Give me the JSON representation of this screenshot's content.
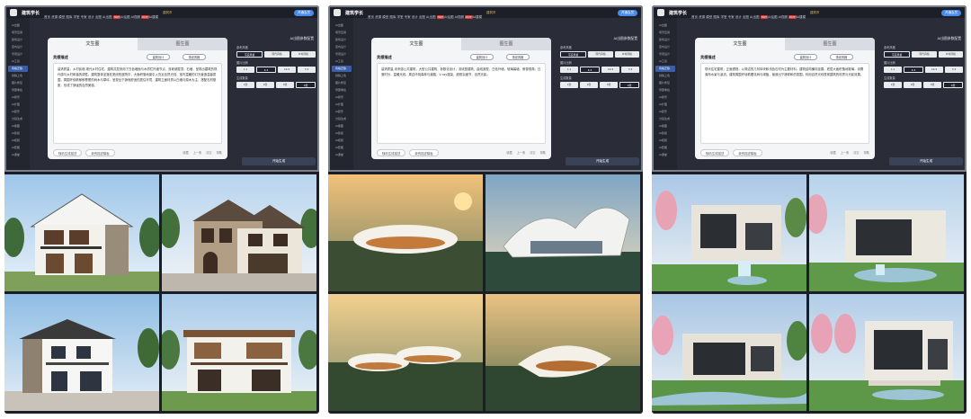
{
  "panels": [
    {
      "app": {
        "brand": "建筑学长",
        "nav": [
          "首页",
          "资源",
          "模型",
          "图库",
          "学堂",
          "专家",
          "设计",
          "出图",
          "AI出图",
          "AI绘图",
          "AI视频",
          "AI建模",
          "AI导入",
          "AI换景",
          "AI插件",
          "AI编辑",
          "AI套图",
          "AI课堂",
          "AI招聘",
          "AI工具",
          "AI渲染"
        ],
        "hot_label": "HOT",
        "coin": "建筑币",
        "vip_button": "开通会员",
        "sidebar": [
          "AI出图",
          "场景应用",
          "建筑设计",
          "室内设计",
          "景观设计",
          "AI工具",
          "风格迁移",
          "线稿上色",
          "图片修复",
          "局部重绘",
          "AI换景",
          "AI扩图",
          "AI配景",
          "分镜生成",
          "AI抠图",
          "AI建模",
          "AI视频",
          "AI套图",
          "AI课堂"
        ],
        "sidebar_active": 6,
        "tabs": [
          "文生图",
          "图生图"
        ],
        "desc_label": "灵感描述",
        "chips": [
          "建筑设计",
          "场景风格"
        ],
        "prompt": "高清质量，乡村民宿,现代乡村住宅，建筑共层采用了白色墙面与木质栏杆细节点，双坡坡屋顶，石墙，呈现出建筑的现代感与乡村和谐的调性，建筑整体坐落在宽阔的庭院中，大面积落地窗引入充足自然光线，室内温暖的灯光营造温馨氛围，周围环绕着郁郁葱葱的树木与草坪，呈现出宁静而舒适的居住环境，建筑立面材质以白墙与原木为主，搭配石材基座，形成了静谧的自然美感。",
        "bottom_buttons": [
          "随机生成描述",
          "我的描述模板"
        ],
        "controls": [
          "收藏",
          "上一条",
          "清空",
          "帮助"
        ],
        "right_title": "AI出图参数配置",
        "right_labels": [
          "参考风格",
          "图片比例",
          "生成数量"
        ],
        "style_row": [
          "写实风格",
          "现代风格",
          "乡村风格"
        ],
        "ratio_row": [
          "1:1",
          "4:3",
          "16:9",
          "3:4"
        ],
        "count_row": [
          "1张",
          "2张",
          "3张",
          "4张"
        ],
        "generate": "开始生成"
      },
      "images": [
        "villa-front-white-stone",
        "villa-stone-tiered",
        "villa-white-balcony",
        "villa-wood-balcony"
      ]
    },
    {
      "app": {
        "brand": "建筑学长",
        "nav": [
          "首页",
          "资源",
          "模型",
          "图库",
          "学堂",
          "专家",
          "设计",
          "出图",
          "AI出图",
          "AI绘图",
          "AI视频",
          "AI建模",
          "AI导入",
          "AI换景",
          "AI插件",
          "AI编辑",
          "AI套图",
          "AI课堂",
          "AI招聘",
          "AI工具",
          "AI渲染"
        ],
        "hot_label": "HOT",
        "coin": "建筑币",
        "vip_button": "开通会员",
        "sidebar": [
          "AI出图",
          "场景应用",
          "建筑设计",
          "室内设计",
          "景观设计",
          "AI工具",
          "风格迁移",
          "线稿上色",
          "图片修复",
          "局部重绘",
          "AI换景",
          "AI扩图",
          "AI配景",
          "分镜生成",
          "AI抠图",
          "AI建模",
          "AI视频",
          "AI套图",
          "AI课堂"
        ],
        "sidebar_active": 6,
        "tabs": [
          "文生图",
          "图生图"
        ],
        "desc_label": "灵感描述",
        "chips": [
          "建筑设计",
          "场景风格"
        ],
        "prompt": "高清质量,未来感公共建筑，大型公共建筑，参数化设计，流线型建筑，曲线造型，白色外墙，玻璃幕墙，俯视视角，日落时分，温暖光线，周边环绕森林与道路，V-ray渲染，超现实细节，自然光影。",
        "bottom_buttons": [
          "随机生成描述",
          "我的描述模板"
        ],
        "controls": [
          "收藏",
          "上一条",
          "清空",
          "帮助"
        ],
        "right_title": "AI出图参数配置",
        "right_labels": [
          "参考风格",
          "图片比例",
          "生成数量"
        ],
        "style_row": [
          "写实风格",
          "现代风格",
          "乡村风格"
        ],
        "ratio_row": [
          "1:1",
          "4:3",
          "16:9",
          "3:4"
        ],
        "count_row": [
          "1张",
          "2张",
          "3张",
          "4张"
        ],
        "generate": "开始生成"
      },
      "images": [
        "parametric-disc-sunset",
        "parametric-wing-roof",
        "parametric-stacked-discs",
        "parametric-loop-forest"
      ]
    },
    {
      "app": {
        "brand": "建筑学长",
        "nav": [
          "首页",
          "资源",
          "模型",
          "图库",
          "学堂",
          "专家",
          "设计",
          "出图",
          "AI出图",
          "AI绘图",
          "AI视频",
          "AI建模",
          "AI导入",
          "AI换景",
          "AI插件",
          "AI编辑",
          "AI套图",
          "AI课堂",
          "AI招聘",
          "AI工具",
          "AI渲染"
        ],
        "hot_label": "HOT",
        "coin": "建筑币",
        "vip_button": "开通会员",
        "sidebar": [
          "AI出图",
          "场景应用",
          "建筑设计",
          "室内设计",
          "景观设计",
          "AI工具",
          "风格迁移",
          "线稿上色",
          "图片修复",
          "局部重绘",
          "AI换景",
          "AI扩图",
          "AI配景",
          "分镜生成",
          "AI抠图",
          "AI建模",
          "AI视频",
          "AI套图",
          "AI课堂"
        ],
        "sidebar_active": 6,
        "tabs": [
          "文生图",
          "图生图"
        ],
        "desc_label": "灵感描述",
        "chips": [
          "建筑设计",
          "场景风格"
        ],
        "prompt": "现代住宅建筑，正面透视，以简洁的几何体块和浅色石材为主要材料，建筑结构横向延展，底层大面积落地玻璃，设置瀑布水景与溪流，建筑周围环绕着樱花树与绿植，营造出宁静祥和的氛围，利用自然光线表现建筑的材质与光影效果。",
        "bottom_buttons": [
          "随机生成描述",
          "我的描述模板"
        ],
        "controls": [
          "收藏",
          "上一条",
          "清空",
          "帮助"
        ],
        "right_title": "AI出图参数配置",
        "right_labels": [
          "参考风格",
          "图片比例",
          "生成数量"
        ],
        "style_row": [
          "写实风格",
          "现代风格",
          "乡村风格"
        ],
        "ratio_row": [
          "1:1",
          "4:3",
          "16:9",
          "3:4"
        ],
        "count_row": [
          "1张",
          "2张",
          "3张",
          "4张"
        ],
        "generate": "开始生成"
      },
      "images": [
        "stone-house-waterfall",
        "stone-house-pond",
        "stone-house-stream",
        "stone-house-cherry"
      ]
    }
  ],
  "colors": {
    "panel_bg": "#1b1e27",
    "accent": "#4a8bea",
    "active_sidebar": "#3a5fa8",
    "hot": "#d93a3a"
  }
}
